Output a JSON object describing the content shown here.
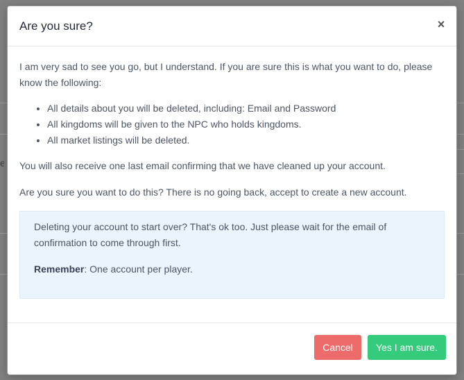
{
  "modal": {
    "title": "Are you sure?",
    "close_symbol": "×",
    "close_icon": "close-icon",
    "intro": "I am very sad to see you go, but I understand. If you are sure this is what you want to do, please know the following:",
    "bullets": [
      "All details about you will be deleted, including: Email and Password",
      "All kingdoms will be given to the NPC who holds kingdoms.",
      "All market listings will be deleted."
    ],
    "email_notice": "You will also receive one last email confirming that we have cleaned up your account.",
    "warning": "Are you sure you want to do this? There is no going back, accept to create a new account.",
    "info": {
      "text": "Deleting your account to start over? That's ok too. Just please wait for the email of confirmation to come through first.",
      "remember_label": "Remember",
      "remember_text": ": One account per player."
    },
    "buttons": {
      "cancel": "Cancel",
      "confirm": "Yes I am sure."
    }
  },
  "background": {
    "partial_letter": "e"
  },
  "colors": {
    "overlay": "#808080",
    "cancel": "#ed6b6b",
    "confirm": "#34cc7c",
    "info_bg": "#ebf4fd"
  }
}
